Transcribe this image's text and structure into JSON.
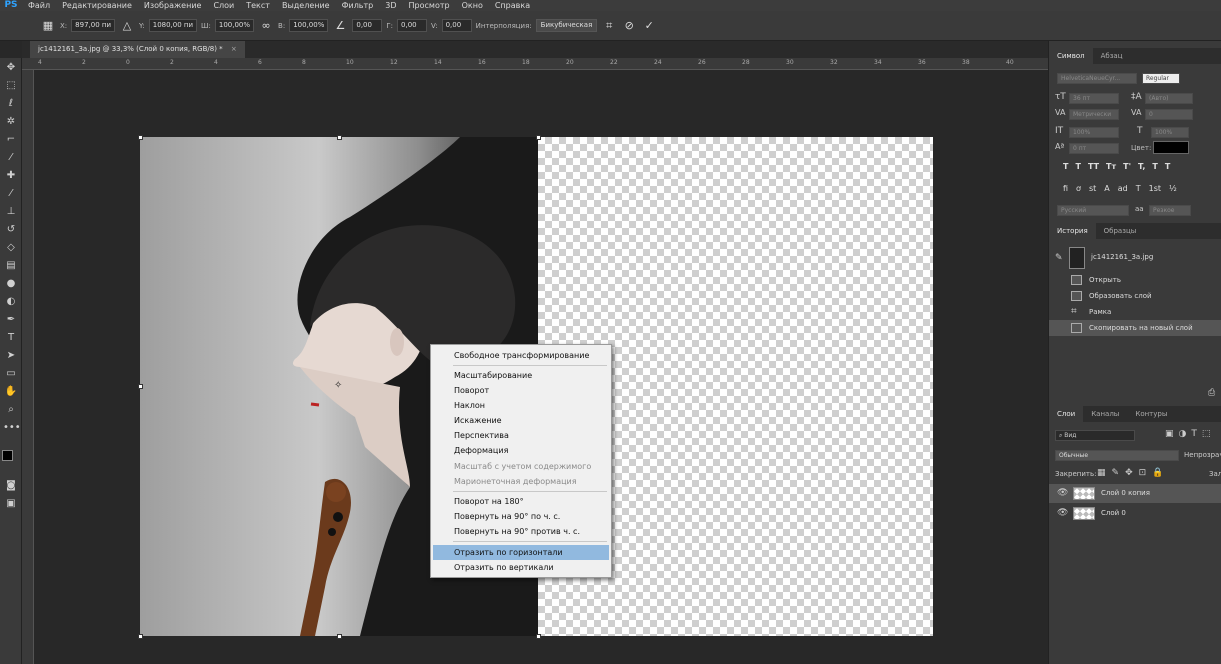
{
  "menu": {
    "logo": "PS",
    "items": [
      "Файл",
      "Редактирование",
      "Изображение",
      "Слои",
      "Текст",
      "Выделение",
      "Фильтр",
      "3D",
      "Просмотр",
      "Окно",
      "Справка"
    ]
  },
  "options": {
    "x_label": "X:",
    "x_value": "897,00 пи",
    "y_label": "Y:",
    "y_value": "1080,00 пи",
    "w_label": "Ш:",
    "w_value": "100,00%",
    "h_label": "В:",
    "h_value": "100,00%",
    "angle_value": "0,00",
    "hskew_label": "Г:",
    "hskew_value": "0,00",
    "vskew_label": "V:",
    "vskew_value": "0,00",
    "interp_label": "Интерполяция:",
    "interp_value": "Бикубическая"
  },
  "document": {
    "tab_title": "jc1412161_3a.jpg @ 33,3% (Слой 0 копия, RGB/8) *",
    "close_glyph": "×"
  },
  "ruler_ticks": [
    "4",
    "2",
    "0",
    "2",
    "4",
    "6",
    "8",
    "10",
    "12",
    "14",
    "16",
    "18",
    "20",
    "22",
    "24",
    "26",
    "28",
    "30",
    "32",
    "34",
    "36",
    "38",
    "40"
  ],
  "context_menu": {
    "items": [
      {
        "label": "Свободное трансформирование",
        "state": "normal"
      },
      {
        "label": "Масштабирование",
        "state": "normal"
      },
      {
        "label": "Поворот",
        "state": "normal"
      },
      {
        "label": "Наклон",
        "state": "normal"
      },
      {
        "label": "Искажение",
        "state": "normal"
      },
      {
        "label": "Перспектива",
        "state": "normal"
      },
      {
        "label": "Деформация",
        "state": "normal"
      },
      {
        "label": "Масштаб с учетом содержимого",
        "state": "disabled"
      },
      {
        "label": "Марионеточная деформация",
        "state": "disabled"
      },
      {
        "label": "Поворот на 180°",
        "state": "normal"
      },
      {
        "label": "Повернуть на 90° по ч. с.",
        "state": "normal"
      },
      {
        "label": "Повернуть на 90° против ч. с.",
        "state": "normal"
      },
      {
        "label": "Отразить по горизонтали",
        "state": "highlighted"
      },
      {
        "label": "Отразить по вертикали",
        "state": "normal"
      }
    ]
  },
  "character_panel": {
    "tabs": [
      "Символ",
      "Абзац"
    ],
    "font_family": "HelveticaNeueCyr...",
    "font_style": "Regular",
    "size": "36 пт",
    "leading": "(Авто)",
    "kerning": "Метрически",
    "tracking": "0",
    "v_scale": "100%",
    "h_scale": "100%",
    "baseline": "0 пт",
    "color_label": "Цвет:",
    "color": "#000000",
    "language": "Русский",
    "aa_label": "аа",
    "antialias": "Резкое",
    "style_buttons": [
      "T",
      "T",
      "TT",
      "Tт",
      "T'",
      "T,",
      "T",
      "T"
    ],
    "opentype_buttons": [
      "fi",
      "ơ",
      "st",
      "A",
      "ad",
      "T",
      "1st",
      "½"
    ]
  },
  "history_panel": {
    "tabs": [
      "История",
      "Образцы"
    ],
    "snapshot": "jc1412161_3a.jpg",
    "steps": [
      "Открыть",
      "Образовать слой",
      "Рамка",
      "Скопировать на новый слой"
    ]
  },
  "layers_panel": {
    "tabs": [
      "Слои",
      "Каналы",
      "Контуры"
    ],
    "filter_label": "Вид",
    "blend_mode": "Обычные",
    "opacity_label": "Непрозрачн",
    "lock_label": "Закрепить:",
    "fill_label": "Зал",
    "layers": [
      {
        "name": "Слой 0 копия",
        "visible": true,
        "selected": true
      },
      {
        "name": "Слой 0",
        "visible": true,
        "selected": false
      }
    ]
  }
}
